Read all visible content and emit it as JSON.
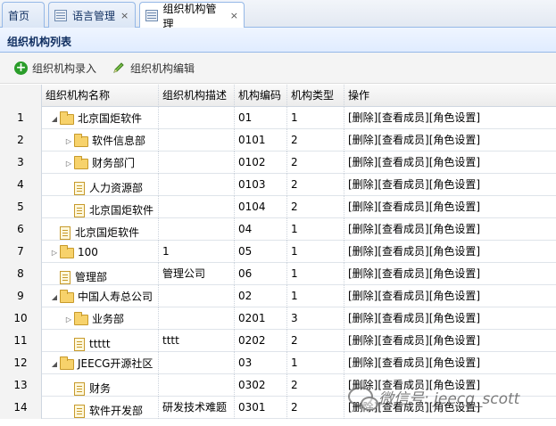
{
  "tabs": [
    {
      "label": "首页",
      "active": false,
      "closable": false
    },
    {
      "label": "语言管理",
      "active": false,
      "closable": true
    },
    {
      "label": "组织机构管理",
      "active": true,
      "closable": true
    }
  ],
  "close_glyph": "×",
  "panel": {
    "title": "组织机构列表"
  },
  "toolbar": {
    "add_label": "组织机构录入",
    "edit_label": "组织机构编辑"
  },
  "grid": {
    "columns": [
      "组织机构名称",
      "组织机构描述",
      "机构编码",
      "机构类型",
      "操作"
    ],
    "ops_label": "[删除][查看成员][角色设置]",
    "rows": [
      {
        "num": "1",
        "name": "北京国炬软件",
        "desc": "",
        "code": "01",
        "type": "1",
        "level": 0,
        "node": "folder",
        "expand": "open"
      },
      {
        "num": "2",
        "name": "软件信息部",
        "desc": "",
        "code": "0101",
        "type": "2",
        "level": 1,
        "node": "folder",
        "expand": "closed"
      },
      {
        "num": "3",
        "name": "财务部门",
        "desc": "",
        "code": "0102",
        "type": "2",
        "level": 1,
        "node": "folder",
        "expand": "closed"
      },
      {
        "num": "4",
        "name": "人力资源部",
        "desc": "",
        "code": "0103",
        "type": "2",
        "level": 1,
        "node": "file",
        "expand": "none"
      },
      {
        "num": "5",
        "name": "北京国炬软件",
        "desc": "",
        "code": "0104",
        "type": "2",
        "level": 1,
        "node": "file",
        "expand": "none"
      },
      {
        "num": "6",
        "name": "北京国炬软件",
        "desc": "",
        "code": "04",
        "type": "1",
        "level": 0,
        "node": "file",
        "expand": "none"
      },
      {
        "num": "7",
        "name": "100",
        "desc": "1",
        "code": "05",
        "type": "1",
        "level": 0,
        "node": "folder",
        "expand": "closed"
      },
      {
        "num": "8",
        "name": "管理部",
        "desc": "管理公司",
        "code": "06",
        "type": "1",
        "level": 0,
        "node": "file",
        "expand": "none"
      },
      {
        "num": "9",
        "name": "中国人寿总公司",
        "desc": "",
        "code": "02",
        "type": "1",
        "level": 0,
        "node": "folder",
        "expand": "open"
      },
      {
        "num": "10",
        "name": "业务部",
        "desc": "",
        "code": "0201",
        "type": "3",
        "level": 1,
        "node": "folder",
        "expand": "closed"
      },
      {
        "num": "11",
        "name": "ttttt",
        "desc": "tttt",
        "code": "0202",
        "type": "2",
        "level": 1,
        "node": "file",
        "expand": "none"
      },
      {
        "num": "12",
        "name": "JEECG开源社区",
        "desc": "",
        "code": "03",
        "type": "1",
        "level": 0,
        "node": "folder",
        "expand": "open"
      },
      {
        "num": "13",
        "name": "财务",
        "desc": "",
        "code": "0302",
        "type": "2",
        "level": 1,
        "node": "file",
        "expand": "none"
      },
      {
        "num": "14",
        "name": "软件开发部",
        "desc": "研发技术难题",
        "code": "0301",
        "type": "2",
        "level": 1,
        "node": "file",
        "expand": "none"
      }
    ]
  },
  "watermark": {
    "text": "微信号: jeecg_scott"
  }
}
